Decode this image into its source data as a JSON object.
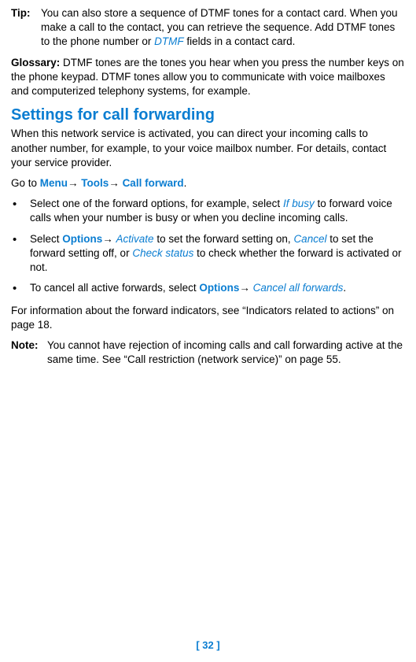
{
  "tip": {
    "label": "Tip:",
    "body_pre": "You can also store a sequence of DTMF tones for a contact card. When you make a call to the contact, you can retrieve the sequence. Add DTMF tones to the phone number or ",
    "link": "DTMF",
    "body_post": " fields in a contact card."
  },
  "glossary": {
    "label": "Glossary:",
    "body": " DTMF tones are the tones you hear when you press the number keys on the phone keypad. DTMF tones allow you to communicate with voice mailboxes and computerized telephony systems, for example."
  },
  "section_title": "Settings for call forwarding",
  "section_intro": "When this network service is activated, you can direct your incoming calls to another number, for example, to your voice mailbox number. For details, contact your service provider.",
  "goto": {
    "pre": "Go to ",
    "m1": "Menu",
    "m2": "Tools",
    "m3": "Call forward",
    "post": "."
  },
  "bullets": {
    "b1": {
      "pre": "Select one of the forward options, for example, select ",
      "ifbusy": "If busy",
      "post": " to forward voice calls when your number is busy or when you decline incoming calls."
    },
    "b2": {
      "pre": "Select ",
      "options": "Options",
      "activate": "Activate",
      "mid1": " to set the forward setting on, ",
      "cancel": "Cancel",
      "mid2": " to set the forward setting off, or ",
      "check": "Check status",
      "post": " to check whether the forward is activated or not."
    },
    "b3": {
      "pre": "To cancel all active forwards, select ",
      "options": "Options",
      "cancelall": "Cancel all forwards",
      "post": "."
    }
  },
  "info_para": "For information about the forward indicators, see “Indicators related to actions” on page 18.",
  "note": {
    "label": "Note:",
    "body": "You cannot have rejection of incoming calls and call forwarding active at the same time. See “Call restriction (network service)” on page 55."
  },
  "page_number": "[ 32 ]"
}
